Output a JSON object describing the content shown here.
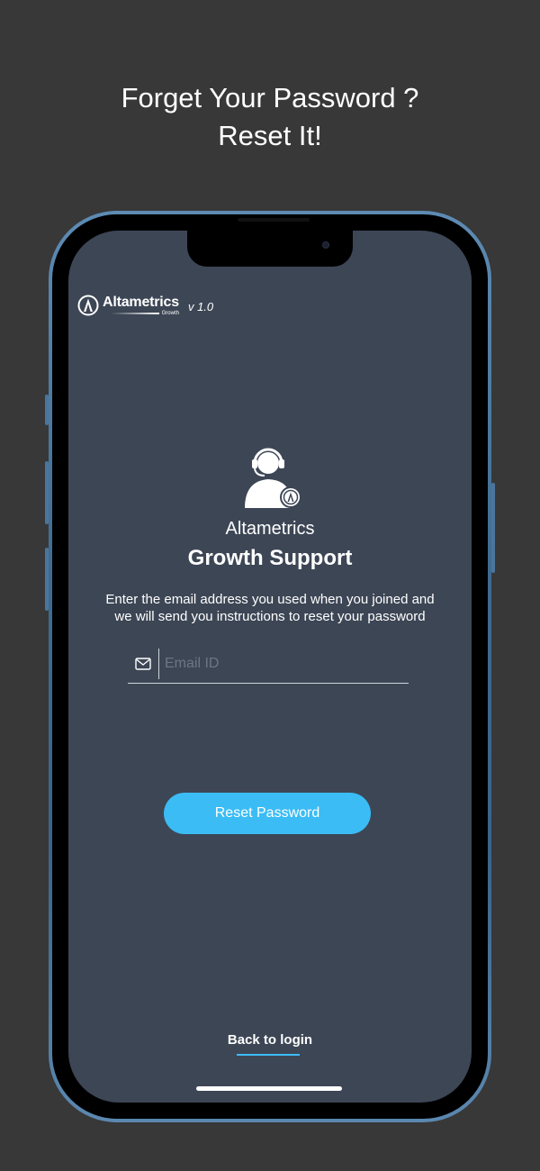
{
  "headline": {
    "line1": "Forget Your Password ?",
    "line2": "Reset It!"
  },
  "brand": {
    "name": "Altametrics",
    "sub": "Growth",
    "version": "v 1.0"
  },
  "support": {
    "company": "Altametrics",
    "title": "Growth Support",
    "instructions": "Enter the email address you used when you joined and we will send you instructions to reset your password"
  },
  "form": {
    "email_placeholder": "Email ID",
    "email_value": "",
    "reset_label": "Reset Password"
  },
  "footer": {
    "back_label": "Back to login"
  },
  "colors": {
    "background": "#383838",
    "screen": "#3d4655",
    "accent": "#3bbcf5",
    "frame": "#4b759c"
  }
}
